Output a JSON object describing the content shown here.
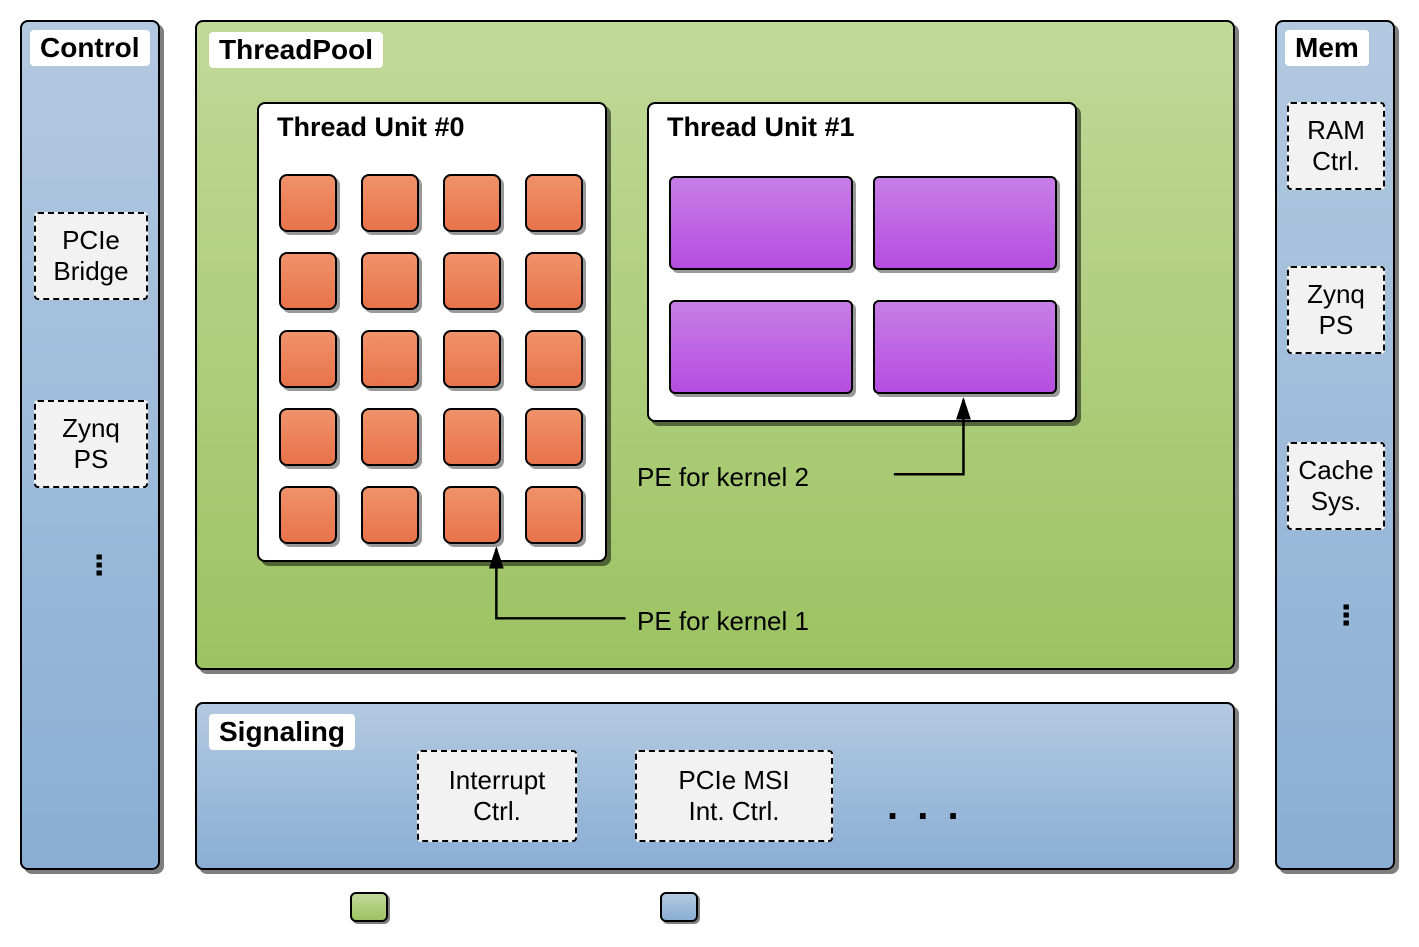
{
  "control": {
    "title": "Control",
    "items": [
      "PCIe\nBridge",
      "Zynq\nPS"
    ]
  },
  "mem": {
    "title": "Mem",
    "items": [
      "RAM\nCtrl.",
      "Zynq\nPS",
      "Cache\nSys."
    ]
  },
  "threadpool": {
    "title": "ThreadPool",
    "unit0": {
      "title": "Thread Unit #0"
    },
    "unit1": {
      "title": "Thread Unit #1"
    },
    "pe1_label": "PE for kernel 1",
    "pe2_label": "PE for kernel 2"
  },
  "signaling": {
    "title": "Signaling",
    "items": [
      "Interrupt\nCtrl.",
      "PCIe MSI\nInt.  Ctrl."
    ]
  }
}
